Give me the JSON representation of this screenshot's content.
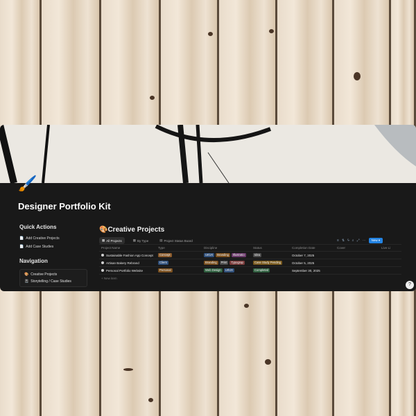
{
  "page": {
    "title": "Designer Portfolio Kit",
    "emoji": "🖌️"
  },
  "quick_actions": {
    "title": "Quick Actions",
    "buttons": [
      "Add Creative Projects",
      "Add Case Studies"
    ]
  },
  "navigation": {
    "title": "Navigation",
    "items": [
      {
        "icon": "🎨",
        "label": "Creative Projects"
      },
      {
        "icon": "📓",
        "label": "Storytelling / Case Studies"
      }
    ]
  },
  "database": {
    "emoji": "🎨",
    "title": "Creative Projects",
    "tabs": [
      "All Projects",
      "By Type",
      "Project Status Board"
    ],
    "new_label": "New",
    "columns": [
      "Project Name",
      "Type",
      "Discipline",
      "Status",
      "Completion Date",
      "Cover",
      "Live Li"
    ],
    "rows": [
      {
        "name": "Sustainable Fashion App Concept",
        "type": "Concept",
        "discipline": [
          "UI/UX",
          "Branding",
          "Illustratio"
        ],
        "status": "Idea",
        "date": "October 7, 2025"
      },
      {
        "name": "Artisan Bakery Rebrand",
        "type": "Client",
        "discipline": [
          "Branding",
          "Print",
          "Typograp"
        ],
        "status": "Case Study Pending",
        "date": "October 5, 2025"
      },
      {
        "name": "Personal Portfolio Website",
        "type": "Personal",
        "discipline": [
          "Web Design",
          "UI/UX"
        ],
        "status": "Completed",
        "date": "September 30, 2025"
      }
    ],
    "new_page_label": "New item"
  },
  "colors": {
    "window_bg": "#191919",
    "accent": "#2383e2",
    "tag_concept": "#8a5a2b",
    "tag_client": "#2f4f7a",
    "tag_personal": "#7a4f1e",
    "tag_uiux": "#2f4f7a",
    "tag_branding": "#7a4f1e",
    "tag_illustration": "#6b3b6b",
    "tag_idea": "#4a4a4a",
    "tag_print": "#4a4a4a",
    "tag_typography": "#7a3b3b",
    "tag_casestudy": "#7a5a1e",
    "tag_webdesign": "#2f5f3f",
    "tag_completed": "#2f5f3f"
  }
}
